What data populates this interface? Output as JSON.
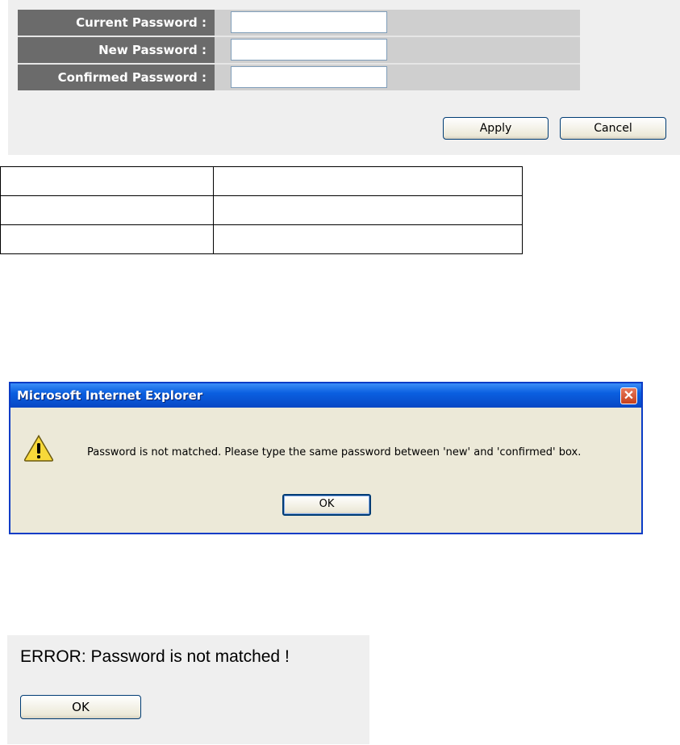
{
  "password_form": {
    "current_label": "Current Password :",
    "new_label": "New Password :",
    "confirmed_label": "Confirmed Password :",
    "current_value": "",
    "new_value": "",
    "confirmed_value": "",
    "apply_label": "Apply",
    "cancel_label": "Cancel"
  },
  "table": {
    "rows": [
      [
        "",
        ""
      ],
      [
        "",
        ""
      ],
      [
        "",
        ""
      ]
    ]
  },
  "ie_dialog": {
    "title": "Microsoft Internet Explorer",
    "message": "Password is not matched. Please type the same password between 'new' and 'confirmed' box.",
    "ok_label": "OK",
    "close_glyph": "✕",
    "icon": "warning-icon"
  },
  "error_panel": {
    "message": "ERROR: Password is not matched !",
    "ok_label": "OK"
  },
  "colors": {
    "label_bg": "#6b6b6b",
    "field_bg": "#cfcfcf",
    "panel_bg": "#efefef",
    "dialog_bg": "#ece9d8",
    "title_bar": "#0a5fe0",
    "close_button": "#c6401c"
  }
}
